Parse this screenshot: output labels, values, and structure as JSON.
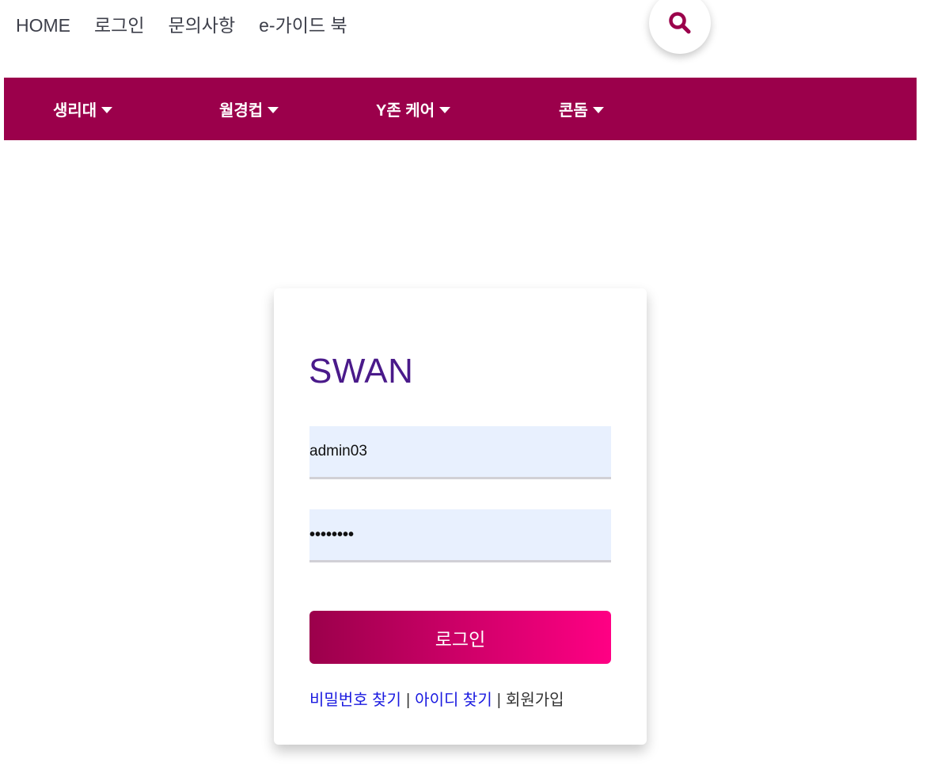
{
  "top_nav": {
    "links": [
      "HOME",
      "로그인",
      "문의사항",
      "e-가이드 북"
    ]
  },
  "search": {
    "icon": "search-icon",
    "color": "#9b004b"
  },
  "main_nav": {
    "bg_color": "#9b004b",
    "items": [
      "생리대",
      "월경컵",
      "Y존 케어",
      "콘돔"
    ]
  },
  "login_card": {
    "brand": "SWAN",
    "brand_color": "#4a1a8a",
    "username_value": "admin03",
    "password_mask": "••••••••",
    "submit_label": "로그인",
    "links": {
      "find_password": "비밀번호 찾기",
      "separator": "|",
      "find_id": "아이디 찾기",
      "signup": "회원가입"
    }
  }
}
